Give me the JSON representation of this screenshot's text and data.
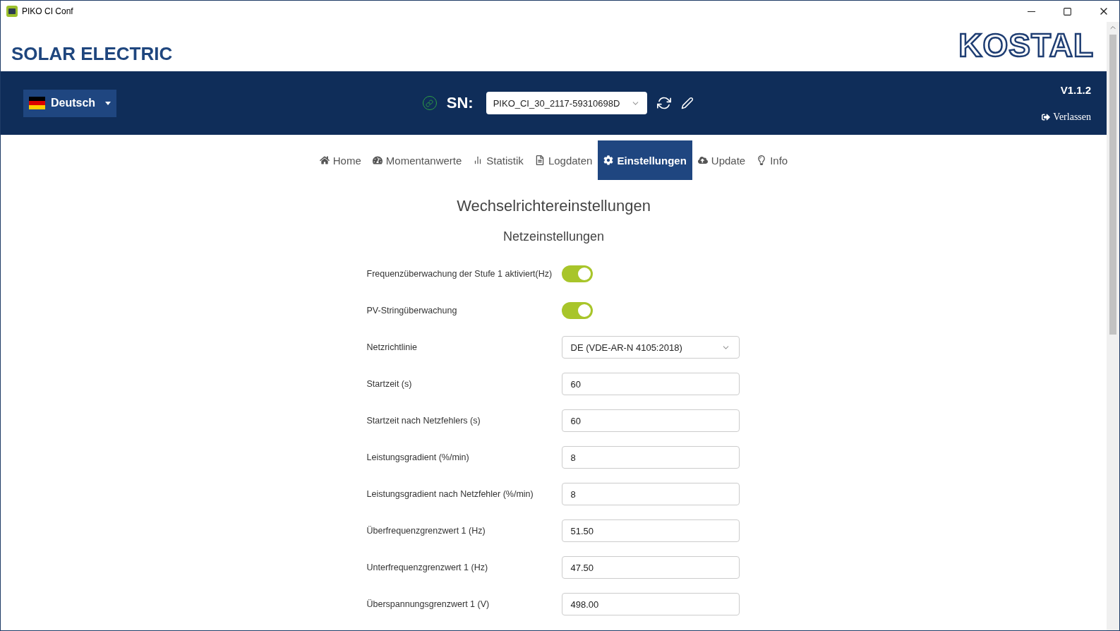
{
  "window": {
    "title": "PIKO CI Conf"
  },
  "header": {
    "brand": "SOLAR ELECTRIC",
    "logo": "KOSTAL"
  },
  "toolbar": {
    "language": "Deutsch",
    "connected": true,
    "sn_label": "SN:",
    "serial": "PIKO_CI_30_2117-59310698D",
    "version": "V1.1.2",
    "exit": "Verlassen"
  },
  "tabs": [
    {
      "label": "Home",
      "selected": false
    },
    {
      "label": "Momentanwerte",
      "selected": false
    },
    {
      "label": "Statistik",
      "selected": false
    },
    {
      "label": "Logdaten",
      "selected": false
    },
    {
      "label": "Einstellungen",
      "selected": true
    },
    {
      "label": "Update",
      "selected": false
    },
    {
      "label": "Info",
      "selected": false
    }
  ],
  "page": {
    "title": "Wechselrichtereinstellungen",
    "section": "Netzeinstellungen"
  },
  "settings": [
    {
      "kind": "toggle",
      "label": "Frequenzüberwachung der Stufe 1 aktiviert(Hz)",
      "on": true
    },
    {
      "kind": "toggle",
      "label": "PV-Stringüberwachung",
      "on": true
    },
    {
      "kind": "select",
      "label": "Netzrichtlinie",
      "value": "DE (VDE-AR-N 4105:2018)"
    },
    {
      "kind": "input",
      "label": "Startzeit (s)",
      "value": "60"
    },
    {
      "kind": "input",
      "label": "Startzeit nach Netzfehlers (s)",
      "value": "60"
    },
    {
      "kind": "input",
      "label": "Leistungsgradient (%/min)",
      "value": "8"
    },
    {
      "kind": "input",
      "label": "Leistungsgradient nach Netzfehler (%/min)",
      "value": "8"
    },
    {
      "kind": "input",
      "label": "Überfrequenzgrenzwert 1 (Hz)",
      "value": "51.50"
    },
    {
      "kind": "input",
      "label": "Unterfrequenzgrenzwert 1 (Hz)",
      "value": "47.50"
    },
    {
      "kind": "input",
      "label": "Überspannungsgrenzwert 1 (V)",
      "value": "498.00"
    }
  ]
}
